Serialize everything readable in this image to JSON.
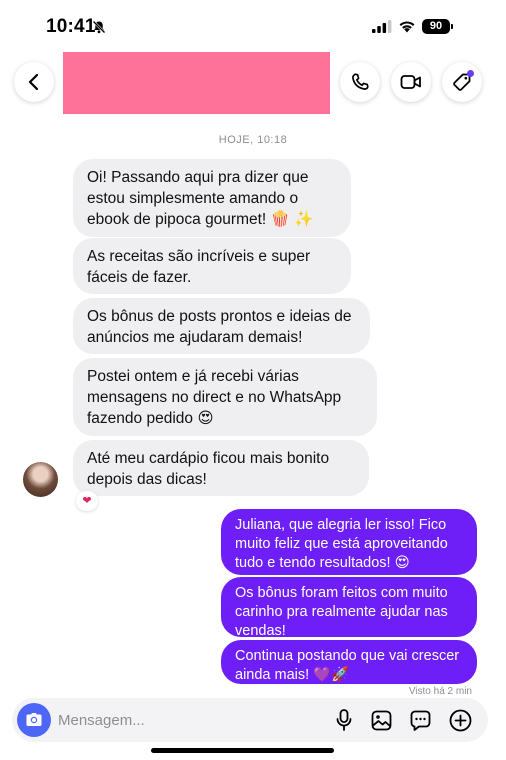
{
  "status_bar": {
    "time": "10:41",
    "battery": "90"
  },
  "header": {
    "contact_name": ""
  },
  "chat": {
    "timestamp": "HOJE, 10:18",
    "incoming": [
      "Oi! Passando aqui pra dizer que estou simplesmente amando o ebook de pipoca gourmet! 🍿 ✨",
      "As receitas são incríveis e super fáceis de fazer.",
      "Os bônus de posts prontos e ideias de anúncios me ajudaram demais!",
      "Postei ontem e já recebi várias mensagens no direct e no WhatsApp fazendo pedido 😍",
      "Até meu cardápio ficou mais bonito depois das dicas!"
    ],
    "reaction": "❤",
    "outgoing": [
      "Juliana, que alegria ler isso! Fico muito feliz que está aproveitando tudo e tendo resultados! 😍",
      "Os bônus foram feitos com muito carinho pra realmente ajudar nas vendas!",
      "Continua postando que vai crescer ainda mais! 💜🚀"
    ],
    "seen": "Visto há 2 min"
  },
  "composer": {
    "placeholder": "Mensagem..."
  },
  "colors": {
    "accent": "#6e1ff7",
    "camera": "#4d66f5",
    "redaction": "#fe7299",
    "incoming_bubble": "#efeff1"
  },
  "icons": [
    "bell-off-icon",
    "signal-icon",
    "wifi-icon",
    "back-icon",
    "phone-icon",
    "video-icon",
    "tag-icon",
    "camera-icon",
    "mic-icon",
    "gallery-icon",
    "sticker-icon",
    "plus-icon"
  ]
}
